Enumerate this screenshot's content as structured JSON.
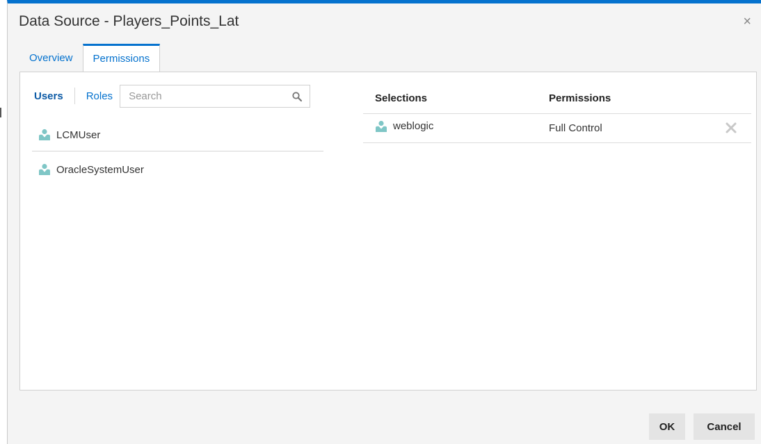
{
  "dialog": {
    "title": "Data Source - Players_Points_Lat",
    "close_glyph": "×"
  },
  "tabs": [
    {
      "label": "Overview",
      "active": false
    },
    {
      "label": "Permissions",
      "active": true
    }
  ],
  "left": {
    "users_tab": "Users",
    "roles_tab": "Roles",
    "search_placeholder": "Search",
    "search_icon": "search-icon",
    "users": [
      {
        "name": "LCMUser",
        "icon": "user-icon"
      },
      {
        "name": "OracleSystemUser",
        "icon": "user-icon"
      }
    ]
  },
  "right": {
    "col_selections": "Selections",
    "col_permissions": "Permissions",
    "rows": [
      {
        "name": "weblogic",
        "icon": "user-icon",
        "permission": "Full Control",
        "remove_icon": "remove-icon"
      }
    ]
  },
  "footer": {
    "ok_label": "OK",
    "cancel_label": "Cancel"
  },
  "colors": {
    "accent": "#0572ce",
    "user_icon": "#7fc6c6",
    "button_bg": "#e4e4e4"
  }
}
